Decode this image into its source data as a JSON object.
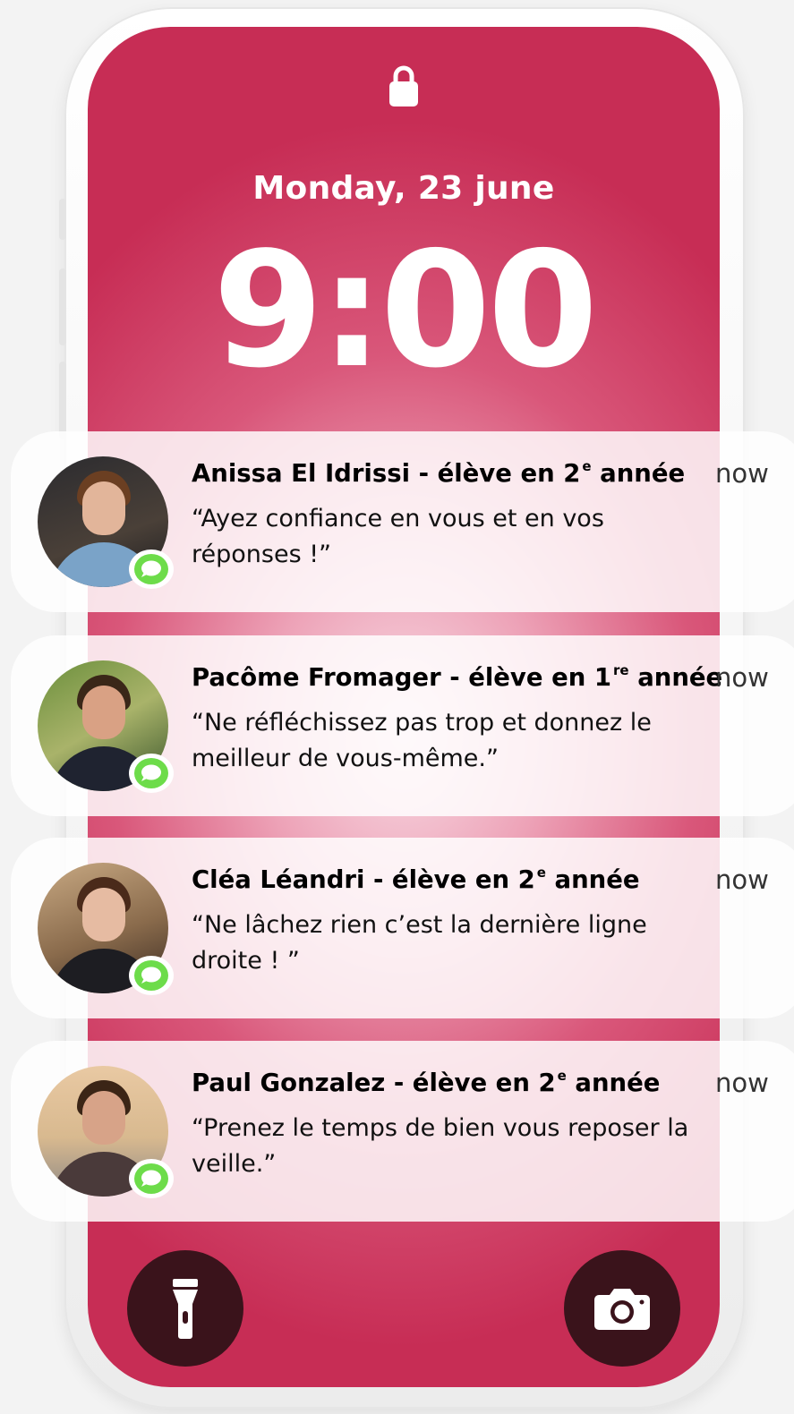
{
  "lockscreen": {
    "date": "Monday, 23 june",
    "time": "9:00",
    "background_color": "#c72d55",
    "lock_icon": "lock-icon"
  },
  "notifications": [
    {
      "name": "Anissa El Idrissi - élève en 2",
      "sup": "e",
      "suffix": "année",
      "message": "“Ayez confiance en vous et en vos réponses !”",
      "time": "now",
      "app_icon": "message-icon"
    },
    {
      "name": "Pacôme Fromager - élève en 1",
      "sup": "re",
      "suffix": "année",
      "message": "“Ne réfléchissez pas trop et donnez le meilleur de vous-même.”",
      "time": "now",
      "app_icon": "message-icon"
    },
    {
      "name": "Cléa Léandri - élève en 2",
      "sup": "e",
      "suffix": "année",
      "message": "“Ne lâchez rien c’est la dernière ligne droite ! ”",
      "time": "now",
      "app_icon": "message-icon"
    },
    {
      "name": "Paul Gonzalez - élève en 2",
      "sup": "e",
      "suffix": "année",
      "message": "“Prenez le temps de bien vous reposer la veille.”",
      "time": "now",
      "app_icon": "message-icon"
    }
  ],
  "quick_actions": {
    "left": "flashlight-icon",
    "right": "camera-icon",
    "color": "#3a131b"
  },
  "badge_color": "#6ddc4a"
}
